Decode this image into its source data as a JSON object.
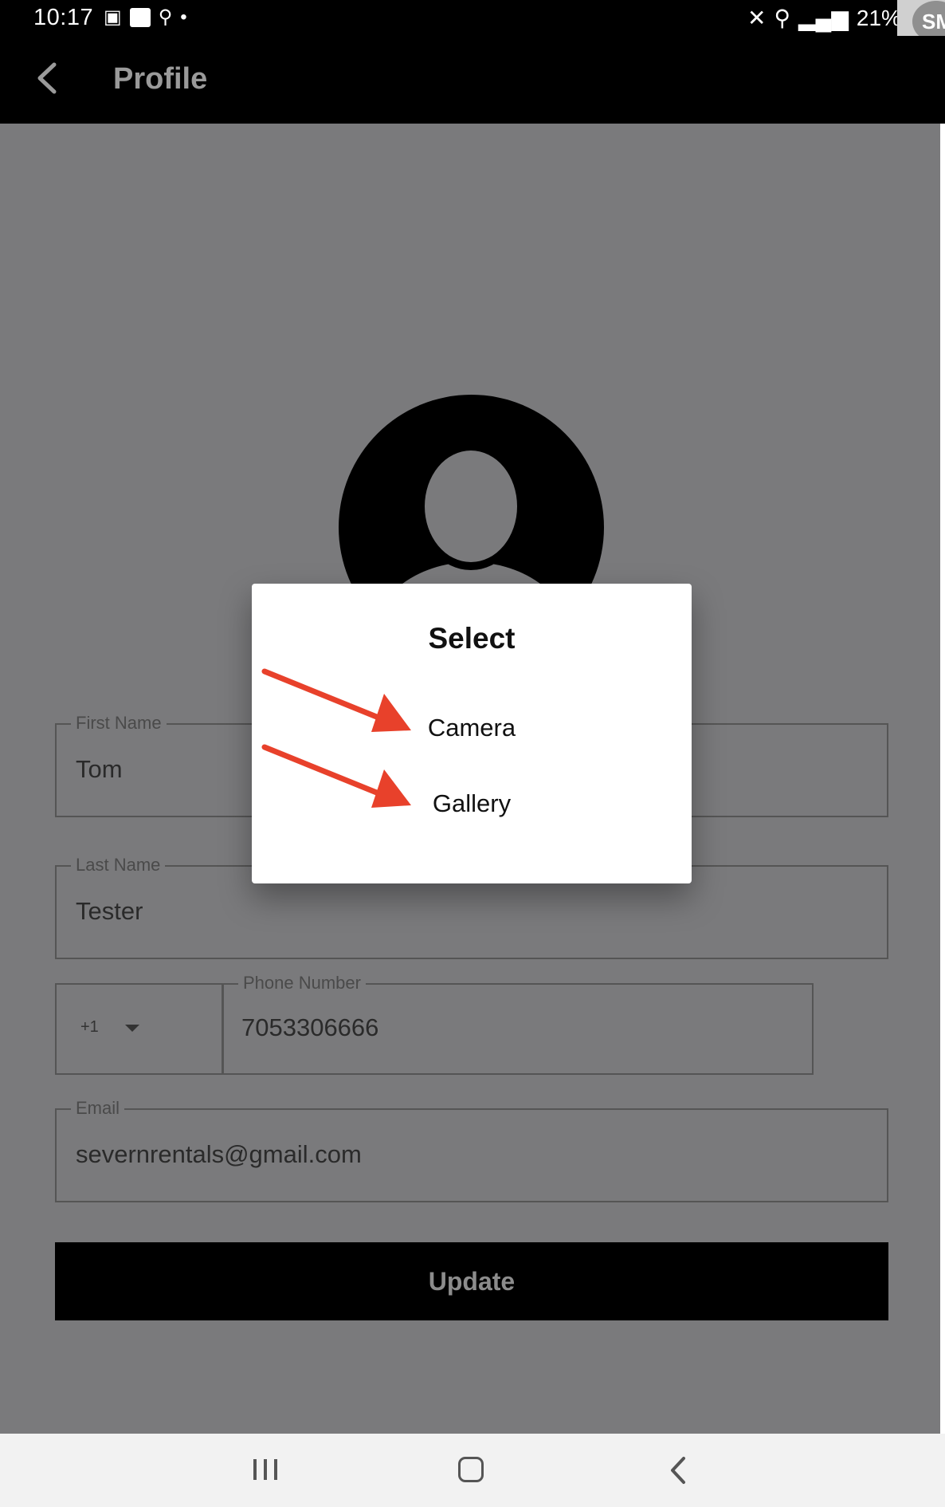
{
  "status_bar": {
    "time": "10:17",
    "battery": "21%",
    "chip_label": "SM"
  },
  "app_bar": {
    "title": "Profile"
  },
  "form": {
    "first_name": {
      "label": "First Name",
      "value": "Tom"
    },
    "last_name": {
      "label": "Last Name",
      "value": "Tester"
    },
    "country_code": {
      "value": "+1"
    },
    "phone": {
      "label": "Phone Number",
      "value": "7053306666"
    },
    "email": {
      "label": "Email",
      "value": "severnrentals@gmail.com"
    },
    "update_label": "Update"
  },
  "dialog": {
    "title": "Select",
    "options": [
      "Camera",
      "Gallery"
    ]
  },
  "colors": {
    "arrow": "#e8412b",
    "overlay": "#7a7a7c"
  }
}
